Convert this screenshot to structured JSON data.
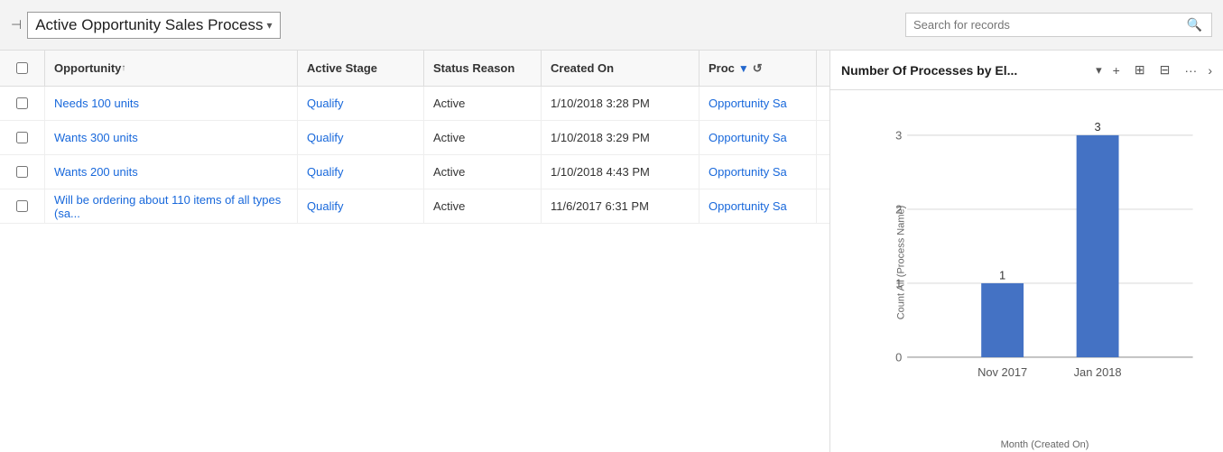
{
  "topbar": {
    "pin_icon": "📌",
    "title": "Active Opportunity Sales Process",
    "chevron": "▾",
    "search_placeholder": "Search for records",
    "search_icon": "🔍"
  },
  "table": {
    "columns": [
      {
        "key": "opportunity",
        "label": "Opportunity",
        "sort": "↑"
      },
      {
        "key": "active_stage",
        "label": "Active Stage"
      },
      {
        "key": "status_reason",
        "label": "Status Reason"
      },
      {
        "key": "created_on",
        "label": "Created On"
      },
      {
        "key": "process",
        "label": "Proc"
      }
    ],
    "rows": [
      {
        "opportunity": "Needs 100 units",
        "active_stage": "Qualify",
        "status_reason": "Active",
        "created_on": "1/10/2018 3:28 PM",
        "process": "Opportunity Sa"
      },
      {
        "opportunity": "Wants 300 units",
        "active_stage": "Qualify",
        "status_reason": "Active",
        "created_on": "1/10/2018 3:29 PM",
        "process": "Opportunity Sa"
      },
      {
        "opportunity": "Wants 200 units",
        "active_stage": "Qualify",
        "status_reason": "Active",
        "created_on": "1/10/2018 4:43 PM",
        "process": "Opportunity Sa"
      },
      {
        "opportunity": "Will be ordering about 110 items of all types (sa...",
        "active_stage": "Qualify",
        "status_reason": "Active",
        "created_on": "11/6/2017 6:31 PM",
        "process": "Opportunity Sa"
      }
    ]
  },
  "chart": {
    "title": "Number Of Processes by El...",
    "y_axis_label": "Count All (Process Name)",
    "x_axis_label": "Month (Created On)",
    "bars": [
      {
        "label": "Nov 2017",
        "value": 1,
        "color": "#4472C4"
      },
      {
        "label": "Jan 2018",
        "value": 3,
        "color": "#4472C4"
      }
    ],
    "y_max": 3,
    "icons": {
      "add": "+",
      "layout": "⊞",
      "save": "💾",
      "more": "···",
      "expand": "›"
    }
  }
}
